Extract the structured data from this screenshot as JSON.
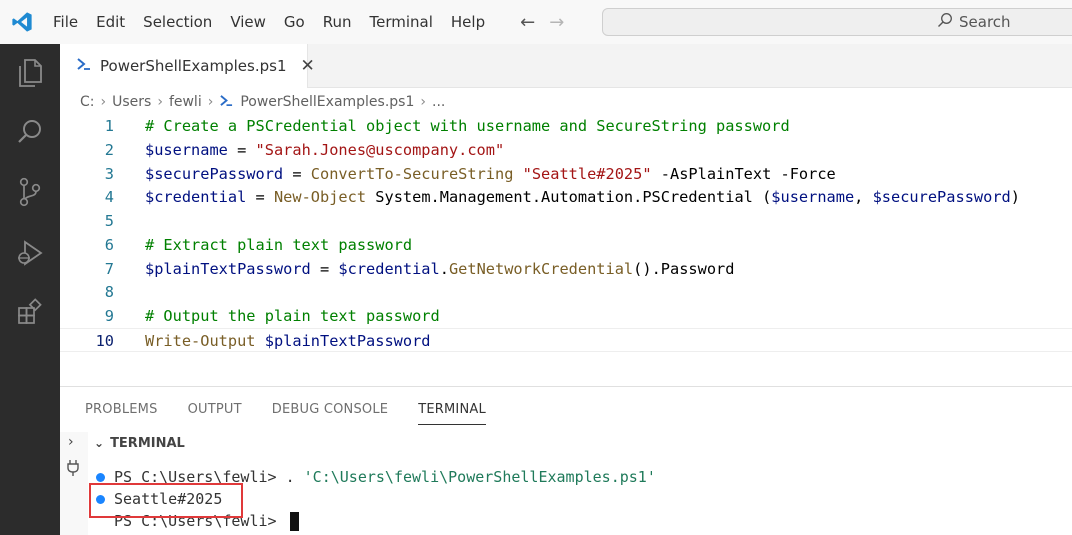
{
  "menu": [
    "File",
    "Edit",
    "Selection",
    "View",
    "Go",
    "Run",
    "Terminal",
    "Help"
  ],
  "search": {
    "label": "Search"
  },
  "tab": {
    "label": "PowerShellExamples.ps1"
  },
  "breadcrumb": [
    "C:",
    "Users",
    "fewli",
    "PowerShellExamples.ps1",
    "..."
  ],
  "editor": {
    "lines": [
      {
        "n": "1",
        "parts": [
          {
            "c": "c-comment",
            "t": "# Create a PSCredential object with username and SecureString password"
          }
        ]
      },
      {
        "n": "2",
        "parts": [
          {
            "c": "c-var",
            "t": "$username"
          },
          {
            "c": "c-op",
            "t": " = "
          },
          {
            "c": "c-str",
            "t": "\"Sarah.Jones@uscompany.com\""
          }
        ]
      },
      {
        "n": "3",
        "parts": [
          {
            "c": "c-var",
            "t": "$securePassword"
          },
          {
            "c": "c-op",
            "t": " = "
          },
          {
            "c": "c-cmd",
            "t": "ConvertTo-SecureString"
          },
          {
            "c": "c-plain",
            "t": " "
          },
          {
            "c": "c-str",
            "t": "\"Seattle#2025\""
          },
          {
            "c": "c-param",
            "t": " -AsPlainText -Force"
          }
        ]
      },
      {
        "n": "4",
        "parts": [
          {
            "c": "c-var",
            "t": "$credential"
          },
          {
            "c": "c-op",
            "t": " = "
          },
          {
            "c": "c-cmd",
            "t": "New-Object"
          },
          {
            "c": "c-plain",
            "t": " System.Management.Automation.PSCredential ("
          },
          {
            "c": "c-var",
            "t": "$username"
          },
          {
            "c": "c-plain",
            "t": ", "
          },
          {
            "c": "c-var",
            "t": "$securePassword"
          },
          {
            "c": "c-plain",
            "t": ")"
          }
        ]
      },
      {
        "n": "5",
        "parts": []
      },
      {
        "n": "6",
        "parts": [
          {
            "c": "c-comment",
            "t": "# Extract plain text password"
          }
        ]
      },
      {
        "n": "7",
        "parts": [
          {
            "c": "c-var",
            "t": "$plainTextPassword"
          },
          {
            "c": "c-op",
            "t": " = "
          },
          {
            "c": "c-var",
            "t": "$credential"
          },
          {
            "c": "c-plain",
            "t": "."
          },
          {
            "c": "c-cmd",
            "t": "GetNetworkCredential"
          },
          {
            "c": "c-plain",
            "t": "().Password"
          }
        ]
      },
      {
        "n": "8",
        "parts": []
      },
      {
        "n": "9",
        "parts": [
          {
            "c": "c-comment",
            "t": "# Output the plain text password"
          }
        ]
      },
      {
        "n": "10",
        "parts": [
          {
            "c": "c-cmd",
            "t": "Write-Output"
          },
          {
            "c": "c-plain",
            "t": " "
          },
          {
            "c": "c-var",
            "t": "$plainTextPassword"
          }
        ]
      }
    ]
  },
  "panel": {
    "tabs": [
      "PROBLEMS",
      "OUTPUT",
      "DEBUG CONSOLE",
      "TERMINAL"
    ],
    "active_tab": "TERMINAL",
    "terminal_header": "TERMINAL"
  },
  "terminal": {
    "prompt1": "PS C:\\Users\\fewli> ",
    "command1_prefix": ". ",
    "command1_path": "'C:\\Users\\fewli\\PowerShellExamples.ps1'",
    "output": "Seattle#2025",
    "prompt2": "PS C:\\Users\\fewli> "
  },
  "colors": {
    "accent": "#1a85ff",
    "highlight": "#e0393a",
    "activity_bg": "#2c2c2c"
  }
}
